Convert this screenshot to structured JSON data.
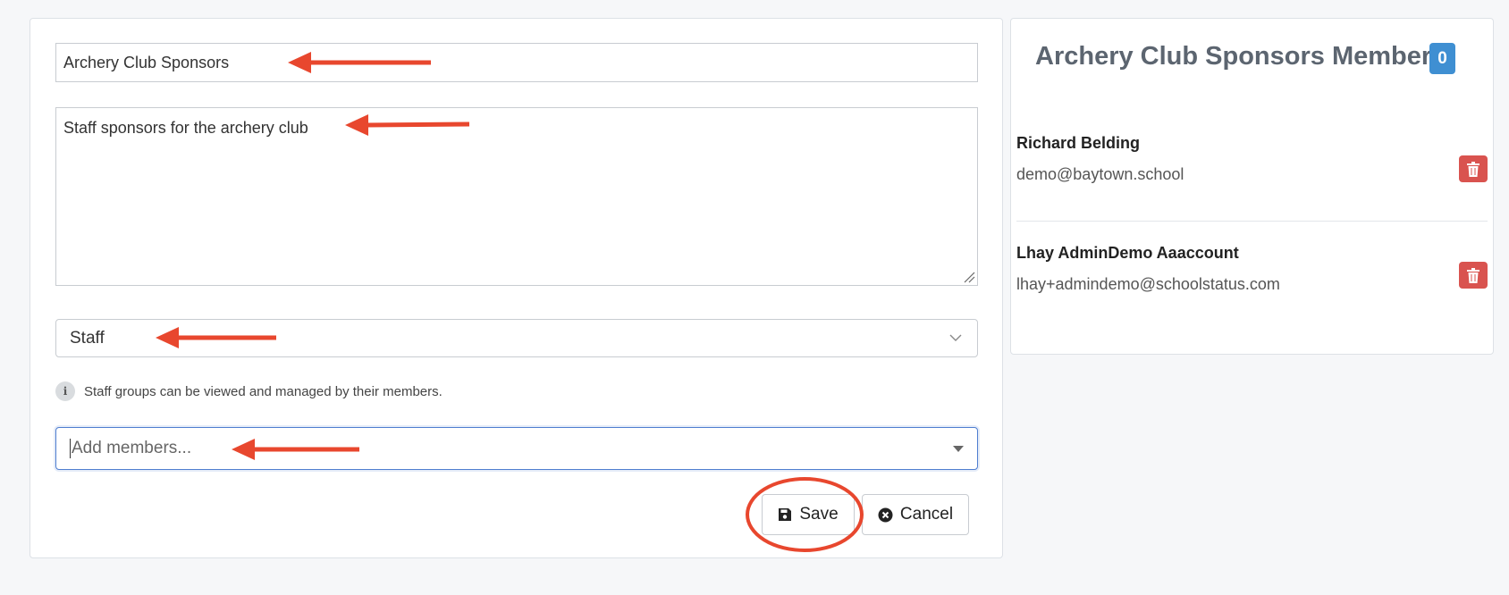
{
  "form": {
    "group_name_value": "Archery Club Sponsors",
    "description_value": "Staff sponsors for the archery club",
    "group_type_selected": "Staff",
    "hint_text": "Staff groups can be viewed and managed by their members.",
    "members_placeholder": "Add members...",
    "save_label": "Save",
    "cancel_label": "Cancel"
  },
  "members_panel": {
    "title": "Archery Club Sponsors Members",
    "count": "0",
    "members": [
      {
        "name": "Richard Belding",
        "email": "demo@baytown.school"
      },
      {
        "name": "Lhay AdminDemo Aaaccount",
        "email": "lhay+admindemo@schoolstatus.com"
      }
    ]
  },
  "colors": {
    "annotation_red": "#e8472e",
    "badge_blue": "#3f8fd2",
    "delete_red": "#d9534f",
    "focus_blue": "#4f7ed0"
  },
  "icons": {
    "save": "floppy-disk-icon",
    "cancel": "times-circle-icon",
    "delete": "trash-icon",
    "info": "info-icon",
    "select": "chevron-down-icon"
  }
}
